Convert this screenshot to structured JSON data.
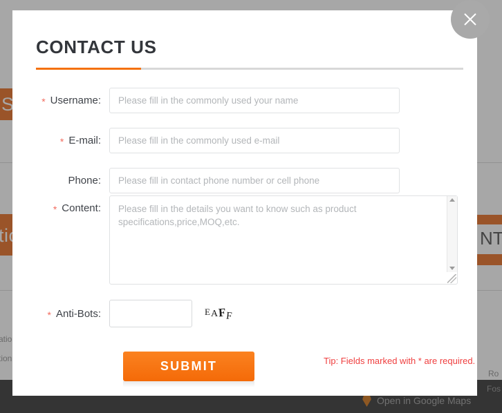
{
  "modal": {
    "title": "CONTACT US",
    "close_icon": "close-icon",
    "fields": [
      {
        "key": "username",
        "label": "Username:",
        "required": true,
        "required_mark": "*",
        "placeholder": "Please fill in the commonly used your name",
        "value": "",
        "type": "text"
      },
      {
        "key": "email",
        "label": "E-mail:",
        "required": true,
        "required_mark": "*",
        "placeholder": "Please fill in the commonly used e-mail",
        "value": "",
        "type": "text"
      },
      {
        "key": "phone",
        "label": "Phone:",
        "required": false,
        "required_mark": "",
        "placeholder": "Please fill in contact phone number or cell phone",
        "value": "",
        "type": "text"
      },
      {
        "key": "content",
        "label": "Content:",
        "required": true,
        "required_mark": "*",
        "placeholder": "Please fill in the details you want to know such as product specifications,price,MOQ,etc.",
        "value": "",
        "type": "textarea"
      },
      {
        "key": "antibots",
        "label": "Anti-Bots:",
        "required": true,
        "required_mark": "*",
        "placeholder": "",
        "value": "",
        "type": "captcha"
      }
    ],
    "captcha": {
      "text": "EAFF",
      "chars": [
        "E",
        "A",
        "F",
        "F"
      ]
    },
    "submit_label": "SUBMIT",
    "tip": "Tip: Fields marked with * are required.",
    "colors": {
      "accent_orange": "#f4700a",
      "required_red": "#f26b5e",
      "tip_red": "#ef3e3e",
      "title_grey": "#33363b",
      "rule_grey": "#d8d8d8"
    }
  },
  "background": {
    "band_left_top_text": "S",
    "band_left_bottom_text": "tio",
    "band_right_text": "NT",
    "footer": {
      "map_link": "Open in Google Maps",
      "pin_icon": "map-pin-icon",
      "right_text_1": "Ro",
      "right_text_2": "Fos"
    },
    "side_text_1": "atio",
    "side_text_2": "tion"
  }
}
